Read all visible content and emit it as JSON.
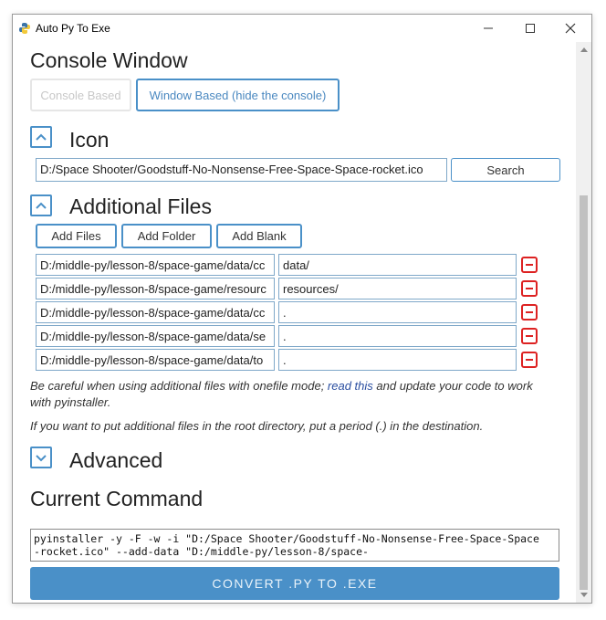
{
  "window": {
    "title": "Auto Py To Exe"
  },
  "console": {
    "heading": "Console Window",
    "console_based": "Console Based",
    "window_based": "Window Based (hide the console)"
  },
  "icon": {
    "heading": "Icon",
    "path": "D:/Space Shooter/Goodstuff-No-Nonsense-Free-Space-Space-rocket.ico",
    "search": "Search"
  },
  "additional": {
    "heading": "Additional Files",
    "add_files": "Add Files",
    "add_folder": "Add Folder",
    "add_blank": "Add Blank",
    "rows": [
      {
        "src": "D:/middle-py/lesson-8/space-game/data/cc",
        "dst": "data/"
      },
      {
        "src": "D:/middle-py/lesson-8/space-game/resourc",
        "dst": "resources/"
      },
      {
        "src": "D:/middle-py/lesson-8/space-game/data/cc",
        "dst": "."
      },
      {
        "src": "D:/middle-py/lesson-8/space-game/data/se",
        "dst": "."
      },
      {
        "src": "D:/middle-py/lesson-8/space-game/data/to",
        "dst": "."
      }
    ],
    "note1_a": "Be careful when using additional files with onefile mode; ",
    "note1_link": "read this",
    "note1_b": " and update your code to work with pyinstaller.",
    "note2": "If you want to put additional files in the root directory, put a period (.) in the destination."
  },
  "advanced": {
    "heading": "Advanced"
  },
  "command": {
    "heading": "Current Command",
    "text": "pyinstaller -y -F -w -i \"D:/Space Shooter/Goodstuff-No-Nonsense-Free-Space-Space-rocket.ico\" --add-data \"D:/middle-py/lesson-8/space-"
  },
  "convert_label": "CONVERT .PY TO .EXE"
}
